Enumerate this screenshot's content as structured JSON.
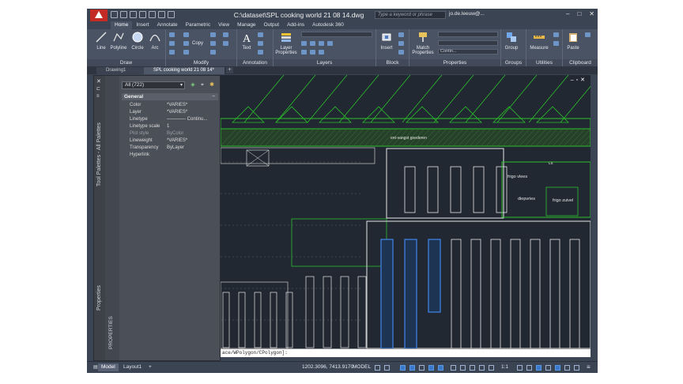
{
  "window": {
    "title": "C:\\dataset\\SPL cooking world 21 08 14.dwg",
    "search_placeholder": "Type a keyword or phrase",
    "user": "jo.de.leeuw@...",
    "controls": [
      "–",
      "□",
      "✕"
    ]
  },
  "ribbon_tabs": [
    "Home",
    "Insert",
    "Annotate",
    "Parametric",
    "View",
    "Manage",
    "Output",
    "Add-ins",
    "Autodesk 360"
  ],
  "ribbon": {
    "draw": {
      "title": "Draw",
      "tools": [
        "Line",
        "Polyline",
        "Circle",
        "Arc"
      ]
    },
    "modify": {
      "title": "Modify",
      "copy": "Copy"
    },
    "annotation": {
      "title": "Annotation",
      "text": "Text"
    },
    "layers": {
      "title": "Layers",
      "layer_properties": "Layer Properties"
    },
    "block": {
      "title": "Block",
      "insert": "Insert"
    },
    "properties": {
      "title": "Properties",
      "match": "Match Properties",
      "linetype": "Contin..."
    },
    "groups": {
      "title": "Groups",
      "group": "Group"
    },
    "utilities": {
      "title": "Utilities",
      "measure": "Measure"
    },
    "clipboard": {
      "title": "Clipboard",
      "paste": "Paste"
    }
  },
  "file_tabs": [
    "Drawing1",
    "SPL cooking world 21 08 14*"
  ],
  "palette": {
    "strip_label_top": "Tool Palettes - All Palettes",
    "strip_label_bottom": "Properties",
    "side_label": "PROPERTIES",
    "selection": "All (722)",
    "section": "General",
    "properties": [
      {
        "key": "Color",
        "value": "*VARIES*"
      },
      {
        "key": "Layer",
        "value": "*VARIES*"
      },
      {
        "key": "Linetype",
        "value": "———— Continu..."
      },
      {
        "key": "Linetype scale",
        "value": "1"
      },
      {
        "key": "Plot style",
        "value": "ByColor"
      },
      {
        "key": "Lineweight",
        "value": "*VARIES*"
      },
      {
        "key": "Transparency",
        "value": "ByLayer"
      },
      {
        "key": "Hyperlink",
        "value": ""
      }
    ]
  },
  "drawing_labels": {
    "corridor": "ent-vangst goederen",
    "room1": "frigo vlees",
    "room2": "diepvries",
    "room3": "frigo zuivel",
    "tag": "LS"
  },
  "command_line": "ace/WPolygon/CPolygon]:",
  "status": {
    "tabs": [
      "Model",
      "Layout1"
    ],
    "coords": "1202.3096, 7413.9170",
    "space": "MODEL",
    "scale": "1:1"
  },
  "colors": {
    "accent_green": "#2bbf2b",
    "selection_blue": "#3d7fe0",
    "background": "#212832"
  }
}
